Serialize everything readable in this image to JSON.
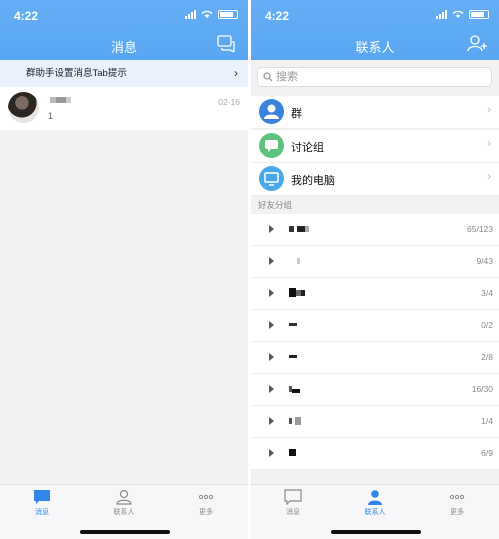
{
  "left": {
    "status_time": "4:22",
    "title": "消息",
    "banner_text": "群助手设置消息Tab提示",
    "banner_chevron": "›",
    "chat": {
      "preview": "1",
      "time": "02-16"
    }
  },
  "right": {
    "status_time": "4:22",
    "title": "联系人",
    "search_placeholder": "搜索",
    "categories": [
      {
        "label": "群",
        "color": "#3b82db"
      },
      {
        "label": "讨论组",
        "color": "#5ec47d"
      },
      {
        "label": "我的电脑",
        "color": "#4aa8e8"
      }
    ],
    "section_label": "好友分组",
    "groups": [
      {
        "count": "65/123"
      },
      {
        "count": "9/43"
      },
      {
        "count": "3/4"
      },
      {
        "count": "0/2"
      },
      {
        "count": "2/8"
      },
      {
        "count": "16/30"
      },
      {
        "count": "1/4"
      },
      {
        "count": "6/9"
      }
    ]
  },
  "tabs": [
    {
      "label": "消息",
      "icon": "message-icon"
    },
    {
      "label": "联系人",
      "icon": "contacts-icon"
    },
    {
      "label": "更多",
      "icon": "more-icon"
    }
  ],
  "colors": {
    "header_blue": "#5aa6f2",
    "active_tab": "#2f86e8",
    "banner_bg": "#e8f1fc"
  }
}
